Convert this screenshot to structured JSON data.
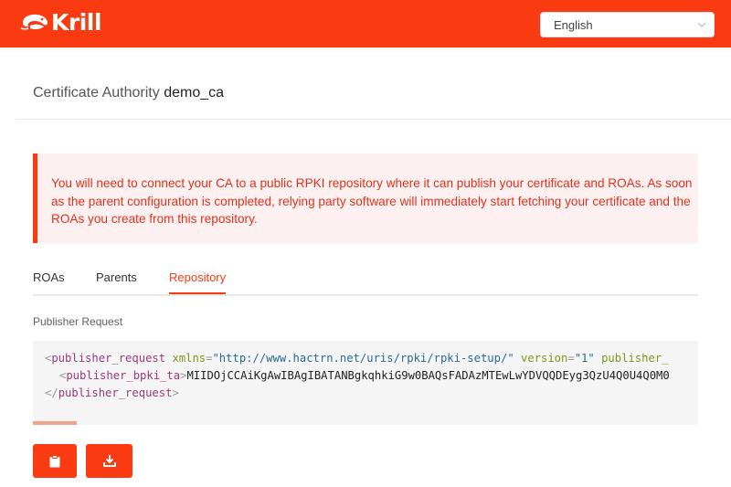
{
  "header": {
    "brand": "Krill",
    "language": "English"
  },
  "page": {
    "title_prefix": "Certificate Authority",
    "ca_name": "demo_ca"
  },
  "alert": {
    "message": "You will need to connect your CA to a public RPKI repository where it can publish your certificate and ROAs. As soon as the parent configuration is completed, relying party software will immediately start fetching your certificate and the ROAs you create from this repository."
  },
  "tabs": [
    {
      "label": "ROAs",
      "active": false
    },
    {
      "label": "Parents",
      "active": false
    },
    {
      "label": "Repository",
      "active": true
    }
  ],
  "publisher": {
    "section_label": "Publisher Request",
    "line1": {
      "lt": "<",
      "tag": "publisher_request",
      "attr1": "xmlns",
      "eq": "=",
      "val1": "\"http://www.hactrn.net/uris/rpki/rpki-setup/\"",
      "attr2": "version",
      "val2": "\"1\"",
      "attr3": "publisher_"
    },
    "line2": {
      "lt": "<",
      "tag": "publisher_bpki_ta",
      "gt": ">",
      "content": "MIIDOjCCAiKgAwIBAgIBATANBgkqhkiG9w0BAQsFADAzMTEwLwYDVQQDEyg3QzU4Q0U4Q0M0"
    },
    "line3": {
      "lt": "</",
      "tag": "publisher_request",
      "gt": ">"
    }
  },
  "actions": [
    {
      "icon": "clipboard-icon"
    },
    {
      "icon": "download-icon"
    }
  ],
  "colors": {
    "brand": "#fa3a10",
    "alert_bg": "#fdf0f0",
    "alert_text": "#e2321b"
  }
}
